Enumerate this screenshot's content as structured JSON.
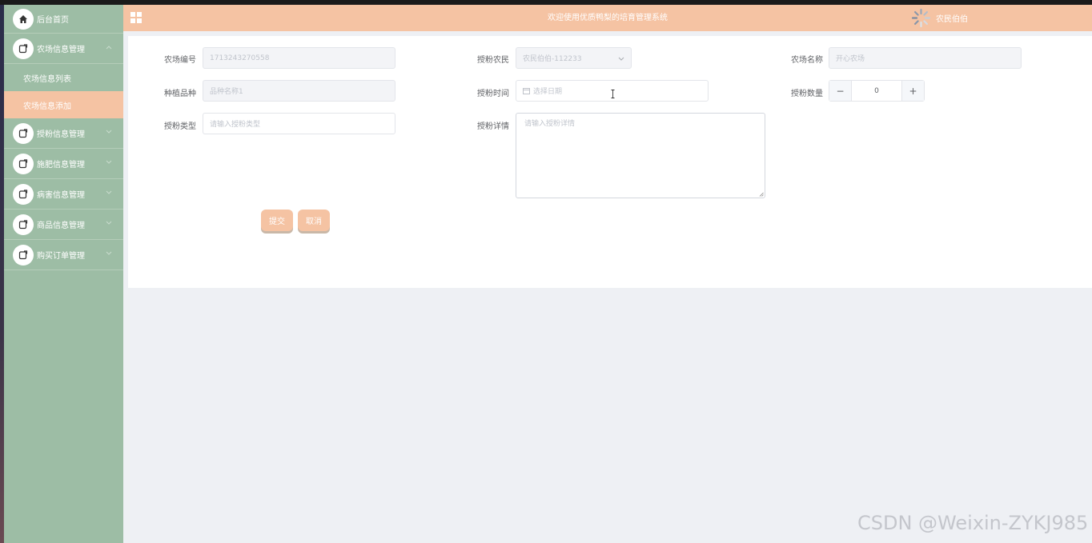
{
  "header": {
    "title": "欢迎使用优质鸭梨的培育管理系统",
    "username": "农民伯伯"
  },
  "sidebar": {
    "home_label": "后台首页",
    "menus": [
      {
        "label": "农场信息管理",
        "expanded": true,
        "sub": [
          "农场信息列表",
          "农场信息添加"
        ],
        "active_sub": 1
      },
      {
        "label": "授粉信息管理"
      },
      {
        "label": "施肥信息管理"
      },
      {
        "label": "病害信息管理"
      },
      {
        "label": "商品信息管理"
      },
      {
        "label": "购买订单管理"
      }
    ]
  },
  "form": {
    "farm_no": {
      "label": "农场编号",
      "value": "1713243270558"
    },
    "pollinate_farmer": {
      "label": "授粉农民",
      "value": "农民伯伯-112233"
    },
    "farm_name": {
      "label": "农场名称",
      "value": "开心农场"
    },
    "variety": {
      "label": "种植品种",
      "value": "品种名称1"
    },
    "pollinate_time": {
      "label": "授粉时间",
      "placeholder": "选择日期"
    },
    "pollinate_qty": {
      "label": "授粉数量",
      "value": "0"
    },
    "pollinate_type": {
      "label": "授粉类型",
      "placeholder": "请输入授粉类型"
    },
    "pollinate_detail": {
      "label": "授粉详情",
      "placeholder": "请输入授粉详情"
    },
    "submit_label": "提交",
    "cancel_label": "取消"
  },
  "colors": {
    "accent": "#f5c3a3",
    "sidebar": "#9dbda5",
    "background": "#eef0f4"
  },
  "watermark": "CSDN @Weixin-ZYKJ985"
}
